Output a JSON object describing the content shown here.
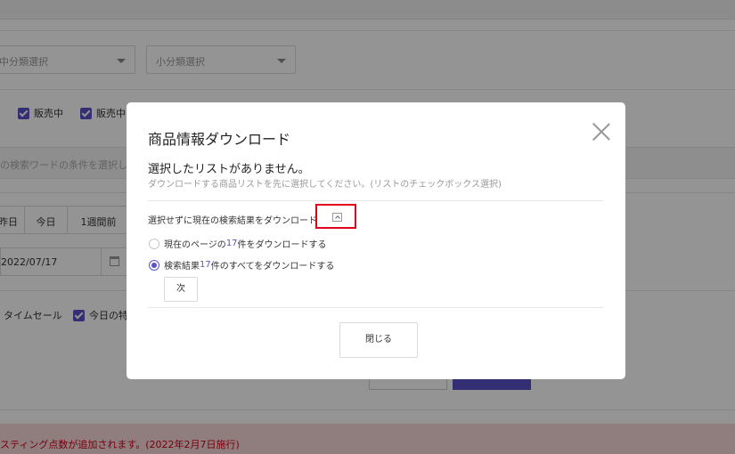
{
  "background": {
    "category_select_1": "中分類選択",
    "category_select_2": "小分類選択",
    "check_on_sale_1": "販売中",
    "check_on_sale_2": "販売中",
    "search_placeholder": "の検索ワードの条件を選択し入",
    "period_yesterday": "昨日",
    "period_today": "今日",
    "period_week": "1週間前",
    "date_value": "2022/07/17",
    "check_time_sale": "タイムセール",
    "check_today": "今日の特",
    "notice": "スティング点数が追加されます。(2022年2月7日施行)"
  },
  "modal": {
    "title": "商品情報ダウンロード",
    "message": "選択したリストがありません。",
    "sub_message": "ダウンロードする商品リストを先に選択してください。(リストのチェックボックス選択)",
    "option_heading": "選択せずに現在の検索結果をダウンロード",
    "option_page": {
      "prefix": "現在のページの",
      "count": "17",
      "suffix": "件をダウンロードする",
      "selected": false
    },
    "option_all": {
      "prefix": "検索結果",
      "count": "17",
      "suffix": "件のすべてをダウンロードする",
      "selected": true
    },
    "next_label": "次",
    "close_label": "閉じる"
  },
  "colors": {
    "accent": "#5b52c7",
    "highlight": "#e2001a",
    "notice_text": "#d0021b",
    "notice_bg": "#f8d7d7"
  }
}
